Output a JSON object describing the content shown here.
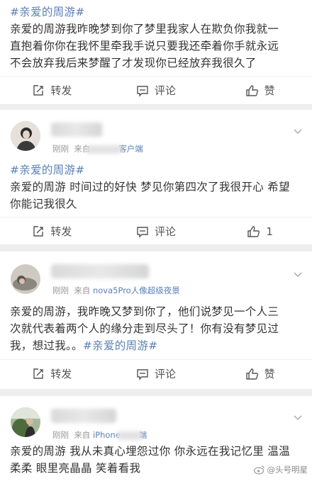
{
  "posts": [
    {
      "tag": "#亲爱的周游#",
      "lines": [
        "亲爱的周游我昨晚梦到你了梦里我家人在欺负你我就一",
        "直抱着你你在我怀里牵我手说只要我还牵着你手就永远",
        "不会放弃我后来梦醒了才发现你已经放弃我很久了"
      ],
      "actions": {
        "repost": "转发",
        "comment": "评论",
        "like": "赞"
      }
    },
    {
      "time": "刚刚",
      "from": "来自",
      "source": "客户端",
      "tag": "#亲爱的周游#",
      "lines": [
        "亲爱的周游 时间过的好快 梦见你第四次了我很开心 希望",
        "你能记我很久"
      ],
      "actions": {
        "repost": "转发",
        "comment": "评论",
        "like": "1"
      }
    },
    {
      "time": "刚刚",
      "from": "来自",
      "source": "nova5Pro人像超级夜景",
      "lines": [
        "亲爱的周游，我昨晚又梦到你了，他们说梦见一个人三",
        "次就代表着两个人的缘分走到尽头了！你有没有梦见过"
      ],
      "last_line_prefix": "我，想过我。。",
      "last_line_tag": "#亲爱的周游#",
      "actions": {
        "repost": "转发",
        "comment": "评论",
        "like": "赞"
      }
    },
    {
      "time": "刚刚",
      "from": "来自",
      "source_a": "iPhone",
      "source_b": "端",
      "lines": [
        "亲爱的周游 我从未真心埋怨过你 你永远在我记忆里 温温",
        "柔柔 眼里亮晶晶 笑着看我"
      ]
    }
  ],
  "watermark": "@头号明星",
  "colors": {
    "tag": "#5b7fb5",
    "text": "#333333",
    "meta": "#999999",
    "background": "#f2f2f2"
  }
}
